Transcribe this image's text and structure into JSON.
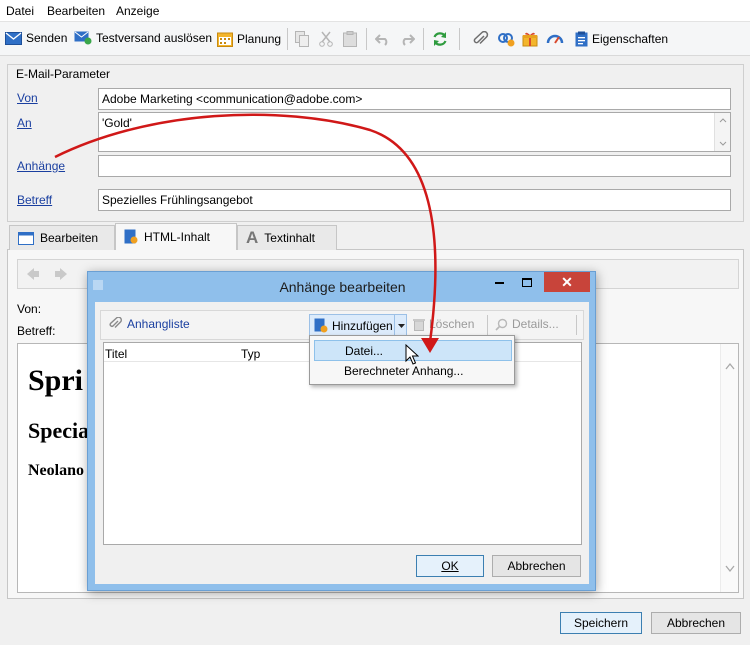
{
  "menubar": {
    "items": [
      "Datei",
      "Bearbeiten",
      "Anzeige"
    ]
  },
  "toolbar": {
    "send_label": "Senden",
    "test_label": "Testversand auslösen",
    "plan_label": "Planung",
    "props_label": "Eigenschaften"
  },
  "params": {
    "title": "E-Mail-Parameter",
    "from_label": "Von",
    "from_value": "Adobe Marketing <communication@adobe.com>",
    "to_label": "An",
    "to_value": "'Gold'",
    "attach_label": "Anhänge",
    "attach_value": "",
    "subject_label": "Betreff",
    "subject_value": "Spezielles Frühlingsangebot"
  },
  "tabs": {
    "t1": "Bearbeiten",
    "t2": "HTML-Inhalt",
    "t3": "Textinhalt"
  },
  "content": {
    "from_label": "Von:",
    "subject_label": "Betreff:",
    "h1": "Spri",
    "h2": "Specia",
    "h3": "Neolano"
  },
  "dialog": {
    "title": "Anhänge bearbeiten",
    "list_label": "Anhangliste",
    "add_label": "Hinzufügen",
    "delete_label": "Löschen",
    "details_label": "Details...",
    "col_title": "Titel",
    "col_type": "Typ",
    "ok_label": "OK",
    "cancel_label": "Abbrechen"
  },
  "dropdown": {
    "item1": "Datei...",
    "item2": "Berechneter Anhang..."
  },
  "footer": {
    "save_label": "Speichern",
    "cancel_label": "Abbrechen"
  },
  "colors": {
    "accent": "#1a3fa0",
    "dialog_frame": "#8fbfeb",
    "arrow": "#d01818",
    "close": "#c8443a"
  }
}
